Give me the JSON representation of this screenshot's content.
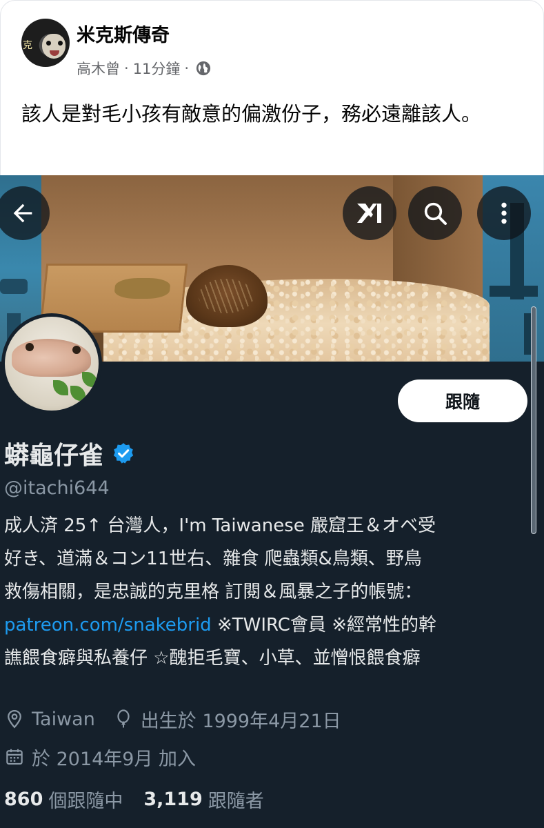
{
  "post": {
    "page_name": "米克斯傳奇",
    "author": "高木曾",
    "separator": "·",
    "time": "11分鐘",
    "privacy_icon": "globe-icon",
    "text": "該人是對毛小孩有敵意的偏激份子，務必遠離該人。"
  },
  "profile": {
    "nav": {
      "back_icon": "arrow-left-icon",
      "grok_icon": "grok-icon",
      "search_icon": "search-icon",
      "more_icon": "more-vertical-icon"
    },
    "follow_label": "跟隨",
    "display_name": "蟒龜仔雀",
    "verified_icon": "verified-badge-icon",
    "handle": "@itachi644",
    "bio": {
      "line1": "成人済  25↑ 台灣人，I'm Taiwanese 嚴窟王＆オベ受",
      "line2": "好き、道滿＆コン11世右、雜食 爬蟲類&鳥類、野鳥",
      "line3": "救傷相關，是忠誠的克里格 訂閱＆風暴之子的帳號：",
      "link": "patreon.com/snakebrid",
      "line4_rest": " ※TWIRC會員 ※經常性的幹",
      "line5": "譙餵食癖與私養仔 ☆醜拒毛寶、小草、並憎恨餵食癖"
    },
    "location": "Taiwan",
    "birthday": "出生於 1999年4月21日",
    "joined": "於 2014年9月 加入",
    "following_count": "860",
    "following_label": "個跟隨中",
    "followers_count": "3,119",
    "followers_label": "跟隨者"
  },
  "colors": {
    "twitter_bg": "#15202b",
    "link_blue": "#1d9bf0",
    "muted": "#8b98a5",
    "fb_text": "#050505",
    "fb_muted": "#65676b"
  }
}
